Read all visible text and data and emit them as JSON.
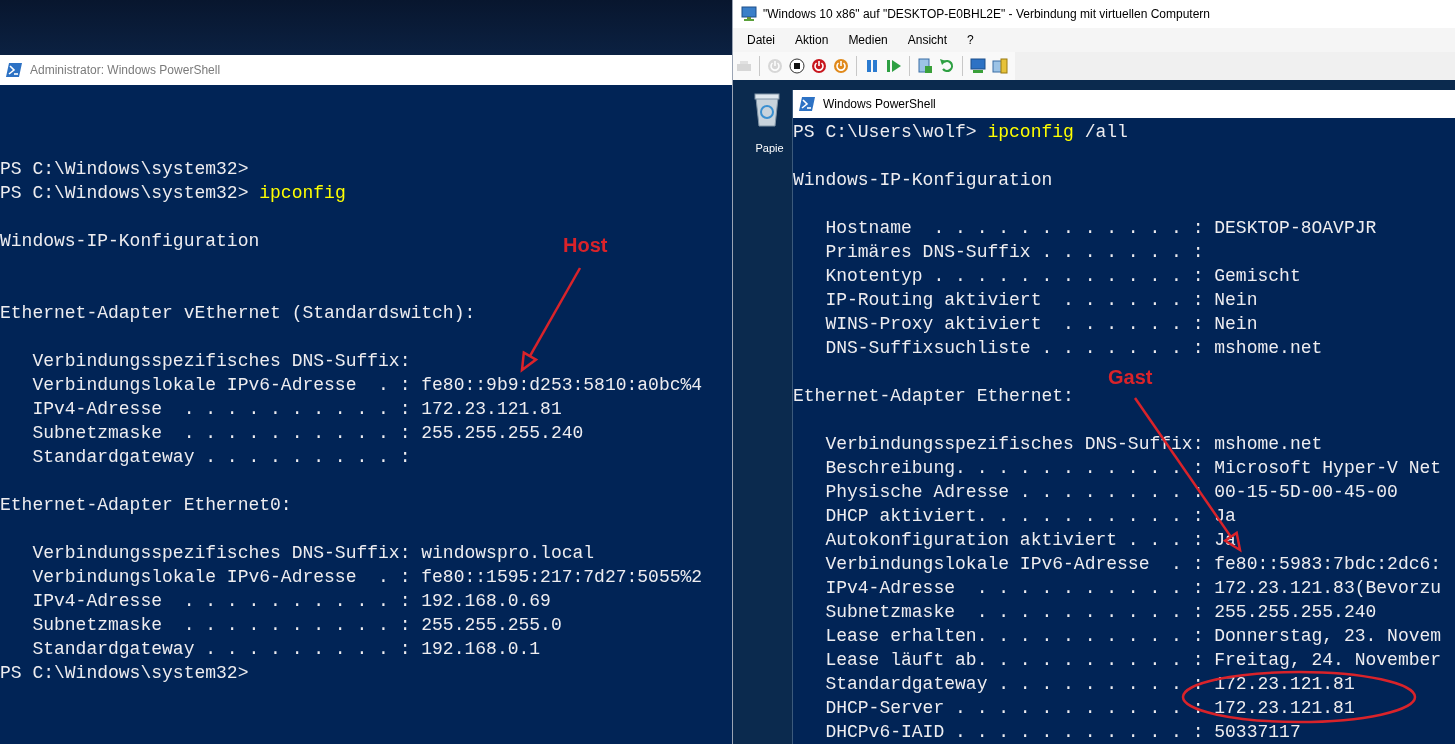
{
  "host_window": {
    "title": "Administrator: Windows PowerShell",
    "lines": [
      {
        "kind": "blank"
      },
      {
        "kind": "blank"
      },
      {
        "kind": "blank"
      },
      {
        "kind": "prompt",
        "prompt": "PS C:\\Windows\\system32>"
      },
      {
        "kind": "prompt",
        "prompt": "PS C:\\Windows\\system32>",
        "command": "ipconfig"
      },
      {
        "kind": "blank"
      },
      {
        "kind": "text",
        "text": "Windows-IP-Konfiguration"
      },
      {
        "kind": "blank"
      },
      {
        "kind": "blank"
      },
      {
        "kind": "text",
        "text": "Ethernet-Adapter vEthernet (Standardswitch):"
      },
      {
        "kind": "blank"
      },
      {
        "kind": "text",
        "text": "   Verbindungsspezifisches DNS-Suffix:"
      },
      {
        "kind": "text",
        "text": "   Verbindungslokale IPv6-Adresse  . : fe80::9b9:d253:5810:a0bc%4"
      },
      {
        "kind": "text",
        "text": "   IPv4-Adresse  . . . . . . . . . . : 172.23.121.81"
      },
      {
        "kind": "text",
        "text": "   Subnetzmaske  . . . . . . . . . . : 255.255.255.240"
      },
      {
        "kind": "text",
        "text": "   Standardgateway . . . . . . . . . :"
      },
      {
        "kind": "blank"
      },
      {
        "kind": "text",
        "text": "Ethernet-Adapter Ethernet0:"
      },
      {
        "kind": "blank"
      },
      {
        "kind": "text",
        "text": "   Verbindungsspezifisches DNS-Suffix: windowspro.local"
      },
      {
        "kind": "text",
        "text": "   Verbindungslokale IPv6-Adresse  . : fe80::1595:217:7d27:5055%2"
      },
      {
        "kind": "text",
        "text": "   IPv4-Adresse  . . . . . . . . . . : 192.168.0.69"
      },
      {
        "kind": "text",
        "text": "   Subnetzmaske  . . . . . . . . . . : 255.255.255.0"
      },
      {
        "kind": "text",
        "text": "   Standardgateway . . . . . . . . . : 192.168.0.1"
      },
      {
        "kind": "prompt",
        "prompt": "PS C:\\Windows\\system32>"
      }
    ]
  },
  "vm_window": {
    "title": "\"Windows 10 x86\" auf \"DESKTOP-E0BHL2E\" - Verbindung mit virtuellen Computern",
    "menu": [
      "Datei",
      "Aktion",
      "Medien",
      "Ansicht",
      "?"
    ],
    "toolbar_groups": [
      {
        "buttons": [
          {
            "kind": "keyboard",
            "disabled": true
          }
        ]
      },
      {
        "buttons": [
          {
            "kind": "start",
            "disabled": true
          },
          {
            "kind": "stop",
            "disabled": false
          },
          {
            "kind": "turn-off",
            "disabled": false
          },
          {
            "kind": "shutdown",
            "disabled": false
          }
        ]
      },
      {
        "buttons": [
          {
            "kind": "pause",
            "disabled": false
          },
          {
            "kind": "resume",
            "disabled": false
          }
        ]
      },
      {
        "buttons": [
          {
            "kind": "checkpoint",
            "disabled": false
          },
          {
            "kind": "revert",
            "disabled": false
          }
        ]
      },
      {
        "buttons": [
          {
            "kind": "network",
            "disabled": false
          },
          {
            "kind": "enhanced",
            "disabled": false
          }
        ]
      }
    ],
    "desktop_icon": {
      "label": "Papie"
    },
    "guest_window": {
      "title": "Windows PowerShell",
      "lines": [
        {
          "kind": "prompt",
          "prompt": "PS C:\\Users\\wolf>",
          "command": "ipconfig",
          "args": "/all"
        },
        {
          "kind": "blank"
        },
        {
          "kind": "text",
          "text": "Windows-IP-Konfiguration"
        },
        {
          "kind": "blank"
        },
        {
          "kind": "text",
          "text": "   Hostname  . . . . . . . . . . . . : DESKTOP-8OAVPJR"
        },
        {
          "kind": "text",
          "text": "   Primäres DNS-Suffix . . . . . . . :"
        },
        {
          "kind": "text",
          "text": "   Knotentyp . . . . . . . . . . . . : Gemischt"
        },
        {
          "kind": "text",
          "text": "   IP-Routing aktiviert  . . . . . . : Nein"
        },
        {
          "kind": "text",
          "text": "   WINS-Proxy aktiviert  . . . . . . : Nein"
        },
        {
          "kind": "text",
          "text": "   DNS-Suffixsuchliste . . . . . . . : mshome.net"
        },
        {
          "kind": "blank"
        },
        {
          "kind": "text",
          "text": "Ethernet-Adapter Ethernet:"
        },
        {
          "kind": "blank"
        },
        {
          "kind": "text",
          "text": "   Verbindungsspezifisches DNS-Suffix: mshome.net"
        },
        {
          "kind": "text",
          "text": "   Beschreibung. . . . . . . . . . . : Microsoft Hyper-V Net"
        },
        {
          "kind": "text",
          "text": "   Physische Adresse . . . . . . . . : 00-15-5D-00-45-00"
        },
        {
          "kind": "text",
          "text": "   DHCP aktiviert. . . . . . . . . . : Ja"
        },
        {
          "kind": "text",
          "text": "   Autokonfiguration aktiviert . . . : Ja"
        },
        {
          "kind": "text",
          "text": "   Verbindungslokale IPv6-Adresse  . : fe80::5983:7bdc:2dc6:"
        },
        {
          "kind": "text",
          "text": "   IPv4-Adresse  . . . . . . . . . . : 172.23.121.83(Bevorzu"
        },
        {
          "kind": "text",
          "text": "   Subnetzmaske  . . . . . . . . . . : 255.255.255.240"
        },
        {
          "kind": "text",
          "text": "   Lease erhalten. . . . . . . . . . : Donnerstag, 23. Novem"
        },
        {
          "kind": "text",
          "text": "   Lease läuft ab. . . . . . . . . . : Freitag, 24. November"
        },
        {
          "kind": "text",
          "text": "   Standardgateway . . . . . . . . . : 172.23.121.81"
        },
        {
          "kind": "text",
          "text": "   DHCP-Server . . . . . . . . . . . : 172.23.121.81"
        },
        {
          "kind": "text",
          "text": "   DHCPv6-IAID . . . . . . . . . . . : 50337117"
        }
      ]
    }
  },
  "annotations": [
    {
      "kind": "label",
      "text": "Host"
    },
    {
      "kind": "arrow"
    },
    {
      "kind": "label",
      "text": "Gast"
    },
    {
      "kind": "arrow"
    },
    {
      "kind": "ellipse"
    }
  ]
}
